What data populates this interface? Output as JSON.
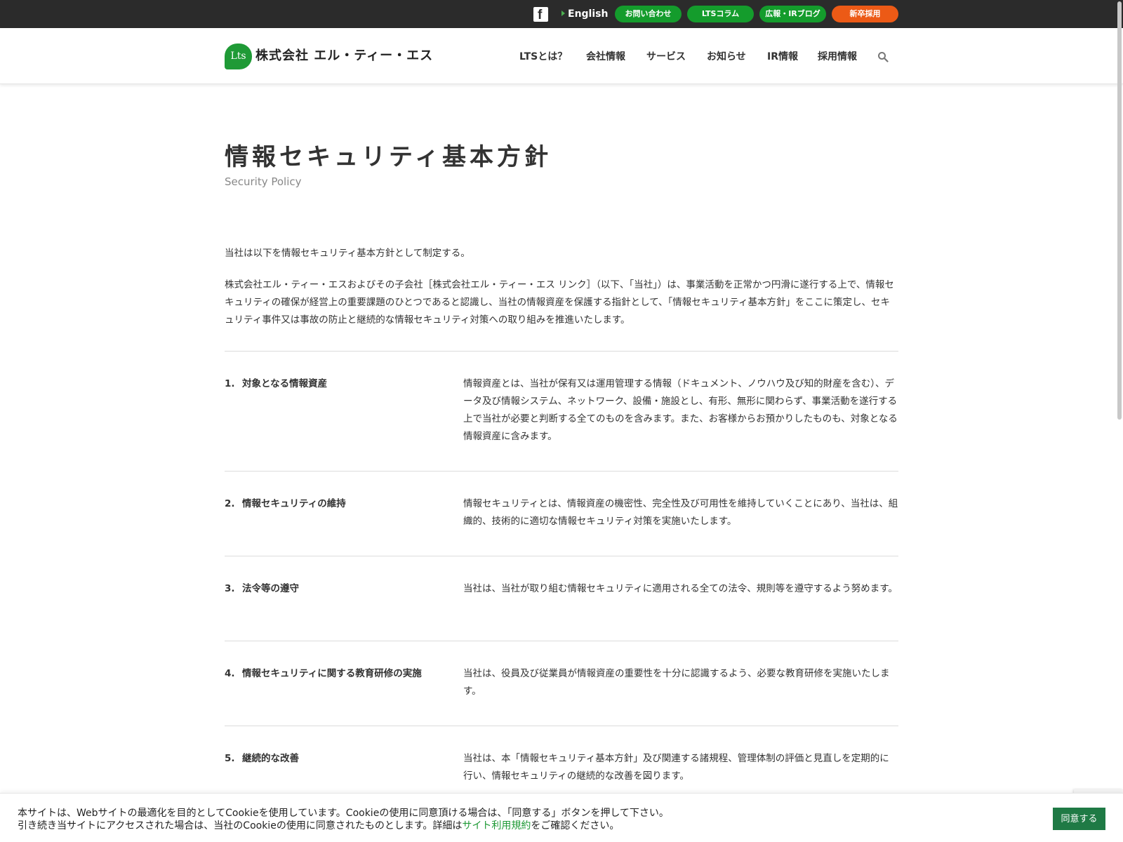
{
  "topbar": {
    "english": "English",
    "buttons": [
      {
        "label": "お問い合わせ",
        "color": "#149c2c"
      },
      {
        "label": "LTSコラム",
        "color": "#149c2c"
      },
      {
        "label": "広報・IRブログ",
        "color": "#149c2c"
      },
      {
        "label": "新卒採用",
        "color": "#ec5a16"
      }
    ]
  },
  "header": {
    "logo_mark": "Lts",
    "logo_text": "株式会社 エル・ティー・エス",
    "nav": [
      "LTSとは？",
      "会社情報",
      "サービス",
      "お知らせ",
      "IR情報",
      "採用情報"
    ]
  },
  "page": {
    "title": "情報セキュリティ基本方針",
    "subtitle": "Security Policy",
    "intro1": "当社は以下を情報セキュリティ基本方針として制定する。",
    "intro2": "株式会社エル・ティー・エスおよびその子会社［株式会社エル・ティー・エス リンク］（以下、「当社」）は、事業活動を正常かつ円滑に遂行する上で、情報セキュリティの確保が経営上の重要課題のひとつであると認識し、当社の情報資産を保護する指針として、「情報セキュリティ基本方針」をここに策定し、セキュリティ事件又は事故の防止と継続的な情報セキュリティ対策への取り組みを推進いたします。"
  },
  "policies": [
    {
      "num": "1.",
      "title": "対象となる情報資産",
      "body": "情報資産とは、当社が保有又は運用管理する情報（ドキュメント、ノウハウ及び知的財産を含む）、データ及び情報システム、ネットワーク、設備・施設とし、有形、無形に関わらず、事業活動を遂行する上で当社が必要と判断する全てのものを含みます。また、お客様からお預かりしたものも、対象となる情報資産に含みます。"
    },
    {
      "num": "2.",
      "title": "情報セキュリティの維持",
      "body": "情報セキュリティとは、情報資産の機密性、完全性及び可用性を維持していくことにあり、当社は、組織的、技術的に適切な情報セキュリティ対策を実施いたします。"
    },
    {
      "num": "3.",
      "title": "法令等の遵守",
      "body": "当社は、当社が取り組む情報セキュリティに適用される全ての法令、規則等を遵守するよう努めます。"
    },
    {
      "num": "4.",
      "title": "情報セキュリティに関する教育研修の実施",
      "body": "当社は、役員及び従業員が情報資産の重要性を十分に認識するよう、必要な教育研修を実施いたします。"
    },
    {
      "num": "5.",
      "title": "継続的な改善",
      "body": "当社は、本「情報セキュリティ基本方針」及び関連する諸規程、管理体制の評価と見直しを定期的に行い、情報セキュリティの継続的な改善を図ります。"
    }
  ],
  "cookie": {
    "line1": "本サイトは、Webサイトの最適化を目的としてCookieを使用しています。Cookieの使用に同意頂ける場合は、「同意する」ボタンを押して下さい。",
    "line2_pre": "引き続き当サイトにアクセスされた場合は、当社のCookieの使用に同意されたものとします。詳細は",
    "line2_link": "サイト利用規約",
    "line2_post": "をご確認ください。",
    "agree_label": "同意する"
  },
  "colors": {
    "brand_green": "#1f9a36",
    "topbar_bg": "#2b2b2b",
    "agree_button": "#1f7a45"
  }
}
